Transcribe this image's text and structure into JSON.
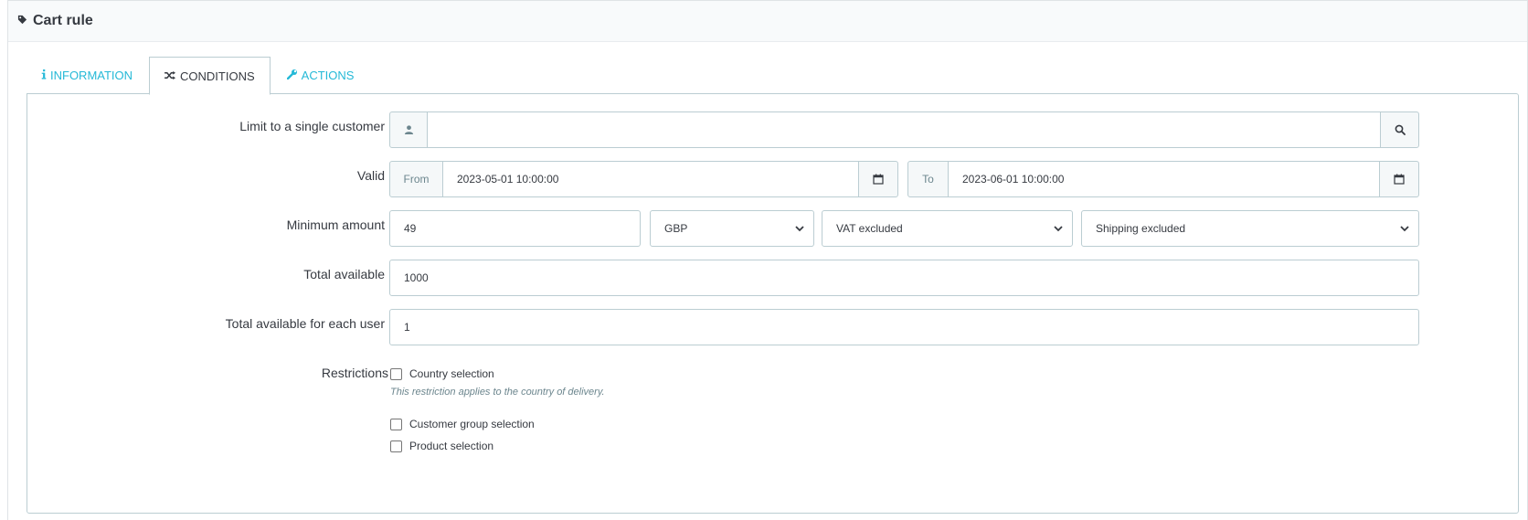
{
  "panel": {
    "title": "Cart rule",
    "title_icon": "tag-icon"
  },
  "tabs": [
    {
      "label": "INFORMATION",
      "icon": "info-icon",
      "active": false
    },
    {
      "label": "CONDITIONS",
      "icon": "shuffle-icon",
      "active": true
    },
    {
      "label": "ACTIONS",
      "icon": "wrench-icon",
      "active": false
    }
  ],
  "form": {
    "customer": {
      "label": "Limit to a single customer",
      "value": "",
      "prefix_icon": "user-icon",
      "suffix_icon": "search-icon"
    },
    "valid": {
      "label": "Valid",
      "from_label": "From",
      "from_value": "2023-05-01 10:00:00",
      "to_label": "To",
      "to_value": "2023-06-01 10:00:00",
      "calendar_icon": "calendar-icon"
    },
    "minimum_amount": {
      "label": "Minimum amount",
      "amount": "49",
      "currency": "GBP",
      "tax": "VAT excluded",
      "shipping": "Shipping excluded"
    },
    "total_available": {
      "label": "Total available",
      "value": "1000"
    },
    "total_per_user": {
      "label": "Total available for each user",
      "value": "1"
    },
    "restrictions": {
      "label": "Restrictions",
      "country": "Country selection",
      "country_help": "This restriction applies to the country of delivery.",
      "customer_group": "Customer group selection",
      "product": "Product selection"
    }
  },
  "colors": {
    "accent": "#25b9d7",
    "border": "#bbcdd2",
    "text": "#363a41",
    "addon_bg": "#f5f8f9"
  }
}
